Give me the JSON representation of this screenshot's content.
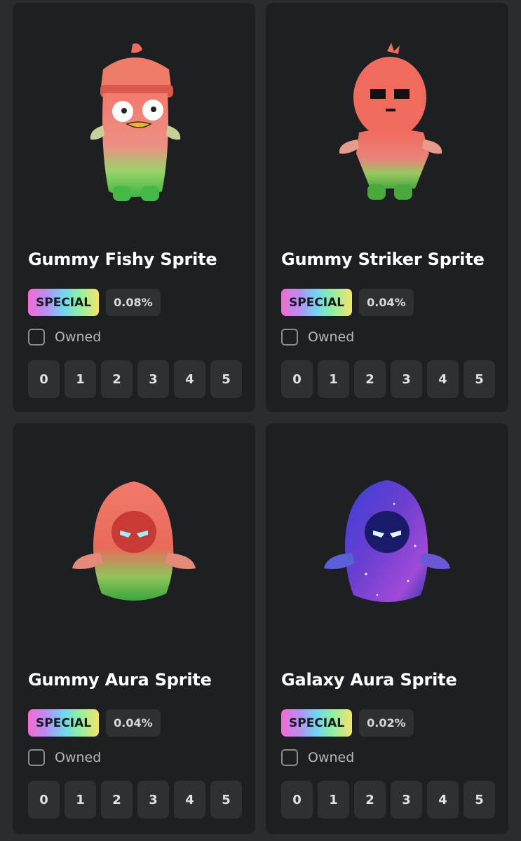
{
  "cards": [
    {
      "name": "Gummy Fishy Sprite",
      "badge": "SPECIAL",
      "chance": "0.08%",
      "owned_label": "Owned",
      "levels": [
        "0",
        "1",
        "2",
        "3",
        "4",
        "5"
      ]
    },
    {
      "name": "Gummy Striker Sprite",
      "badge": "SPECIAL",
      "chance": "0.04%",
      "owned_label": "Owned",
      "levels": [
        "0",
        "1",
        "2",
        "3",
        "4",
        "5"
      ]
    },
    {
      "name": "Gummy Aura Sprite",
      "badge": "SPECIAL",
      "chance": "0.04%",
      "owned_label": "Owned",
      "levels": [
        "0",
        "1",
        "2",
        "3",
        "4",
        "5"
      ]
    },
    {
      "name": "Galaxy Aura Sprite",
      "badge": "SPECIAL",
      "chance": "0.02%",
      "owned_label": "Owned",
      "levels": [
        "0",
        "1",
        "2",
        "3",
        "4",
        "5"
      ]
    }
  ],
  "colors": {
    "background": "#2b2c30",
    "card": "#1e1f22",
    "chip": "#2f3034",
    "gummy_red": "#f06a6a",
    "gummy_green": "#4fc04a",
    "galaxy_purple": "#6b3fd0"
  }
}
